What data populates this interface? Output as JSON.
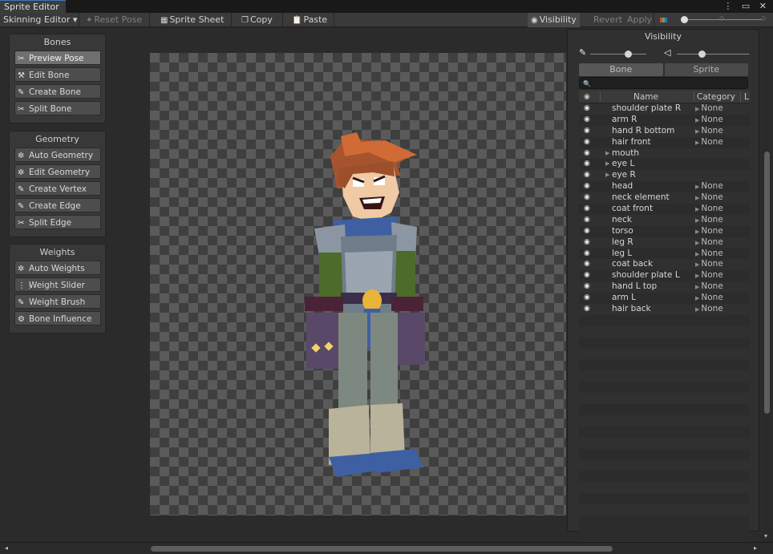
{
  "window": {
    "tab_title": "Sprite Editor",
    "controls": "⋮ ▭ ✕"
  },
  "toolbar": {
    "mode_dropdown": "Skinning Editor ▾",
    "reset_pose": "Reset Pose",
    "sprite_sheet": "Sprite Sheet",
    "copy": "Copy",
    "paste": "Paste",
    "visibility": "Visibility",
    "revert": "Revert",
    "apply": "Apply"
  },
  "bones_panel": {
    "title": "Bones",
    "buttons": [
      "Preview Pose",
      "Edit Bone",
      "Create Bone",
      "Split Bone"
    ]
  },
  "geometry_panel": {
    "title": "Geometry",
    "buttons": [
      "Auto Geometry",
      "Edit Geometry",
      "Create Vertex",
      "Create Edge",
      "Split Edge"
    ]
  },
  "weights_panel": {
    "title": "Weights",
    "buttons": [
      "Auto Weights",
      "Weight Slider",
      "Weight Brush",
      "Bone Influence"
    ]
  },
  "visibility_panel": {
    "title": "Visibility",
    "tabs": [
      "Bone",
      "Sprite"
    ],
    "search_placeholder": "",
    "columns": {
      "name": "Name",
      "category": "Category",
      "extra": "L"
    },
    "rows": [
      {
        "name": "shoulder plate R",
        "category": "None",
        "expandable": false
      },
      {
        "name": "arm R",
        "category": "None",
        "expandable": false
      },
      {
        "name": "hand R bottom",
        "category": "None",
        "expandable": false
      },
      {
        "name": "hair front",
        "category": "None",
        "expandable": false
      },
      {
        "name": "mouth",
        "category": "",
        "expandable": true
      },
      {
        "name": "eye L",
        "category": "",
        "expandable": true
      },
      {
        "name": "eye R",
        "category": "",
        "expandable": true
      },
      {
        "name": "head",
        "category": "None",
        "expandable": false
      },
      {
        "name": "neck element",
        "category": "None",
        "expandable": false
      },
      {
        "name": "coat front",
        "category": "None",
        "expandable": false
      },
      {
        "name": "neck",
        "category": "None",
        "expandable": false
      },
      {
        "name": "torso",
        "category": "None",
        "expandable": false
      },
      {
        "name": "leg R",
        "category": "None",
        "expandable": false
      },
      {
        "name": "leg L",
        "category": "None",
        "expandable": false
      },
      {
        "name": "coat back",
        "category": "None",
        "expandable": false
      },
      {
        "name": "shoulder plate L",
        "category": "None",
        "expandable": false
      },
      {
        "name": "hand L top",
        "category": "None",
        "expandable": false
      },
      {
        "name": "arm L",
        "category": "None",
        "expandable": false
      },
      {
        "name": "hair back",
        "category": "None",
        "expandable": false
      }
    ]
  },
  "colors": {
    "accent": "#3a79bb",
    "background": "#282828",
    "panel": "#383838"
  }
}
